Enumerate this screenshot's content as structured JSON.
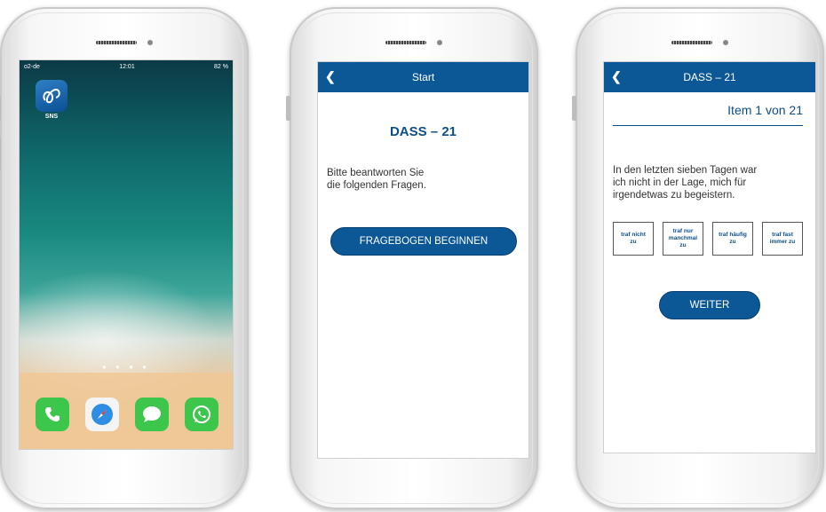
{
  "phone1": {
    "status": {
      "carrier": "o2-de",
      "time": "12:01",
      "battery": "82 %"
    },
    "app": {
      "label": "SNS"
    },
    "dock_icons": [
      "phone-icon",
      "safari-icon",
      "messages-icon",
      "whatsapp-icon"
    ]
  },
  "phone2": {
    "nav": {
      "back": "❮",
      "title": "Start"
    },
    "heading": "DASS – 21",
    "intro": "Bitte beantworten Sie\ndie folgenden Fragen.",
    "button": "FRAGEBOGEN BEGINNEN"
  },
  "phone3": {
    "nav": {
      "back": "❮",
      "title": "DASS – 21"
    },
    "item_count": "Item 1 von 21",
    "question": "In den letzten sieben Tagen war\nich nicht in der Lage, mich für\nirgendetwas zu begeistern.",
    "options": [
      "traf nicht\nzu",
      "traf nur\nmanchmal\nzu",
      "traf häufig\nzu",
      "traf fast\nimmer zu"
    ],
    "button": "WEITER"
  },
  "colors": {
    "brand": "#0c5795",
    "text_accent": "#0c4f86"
  }
}
